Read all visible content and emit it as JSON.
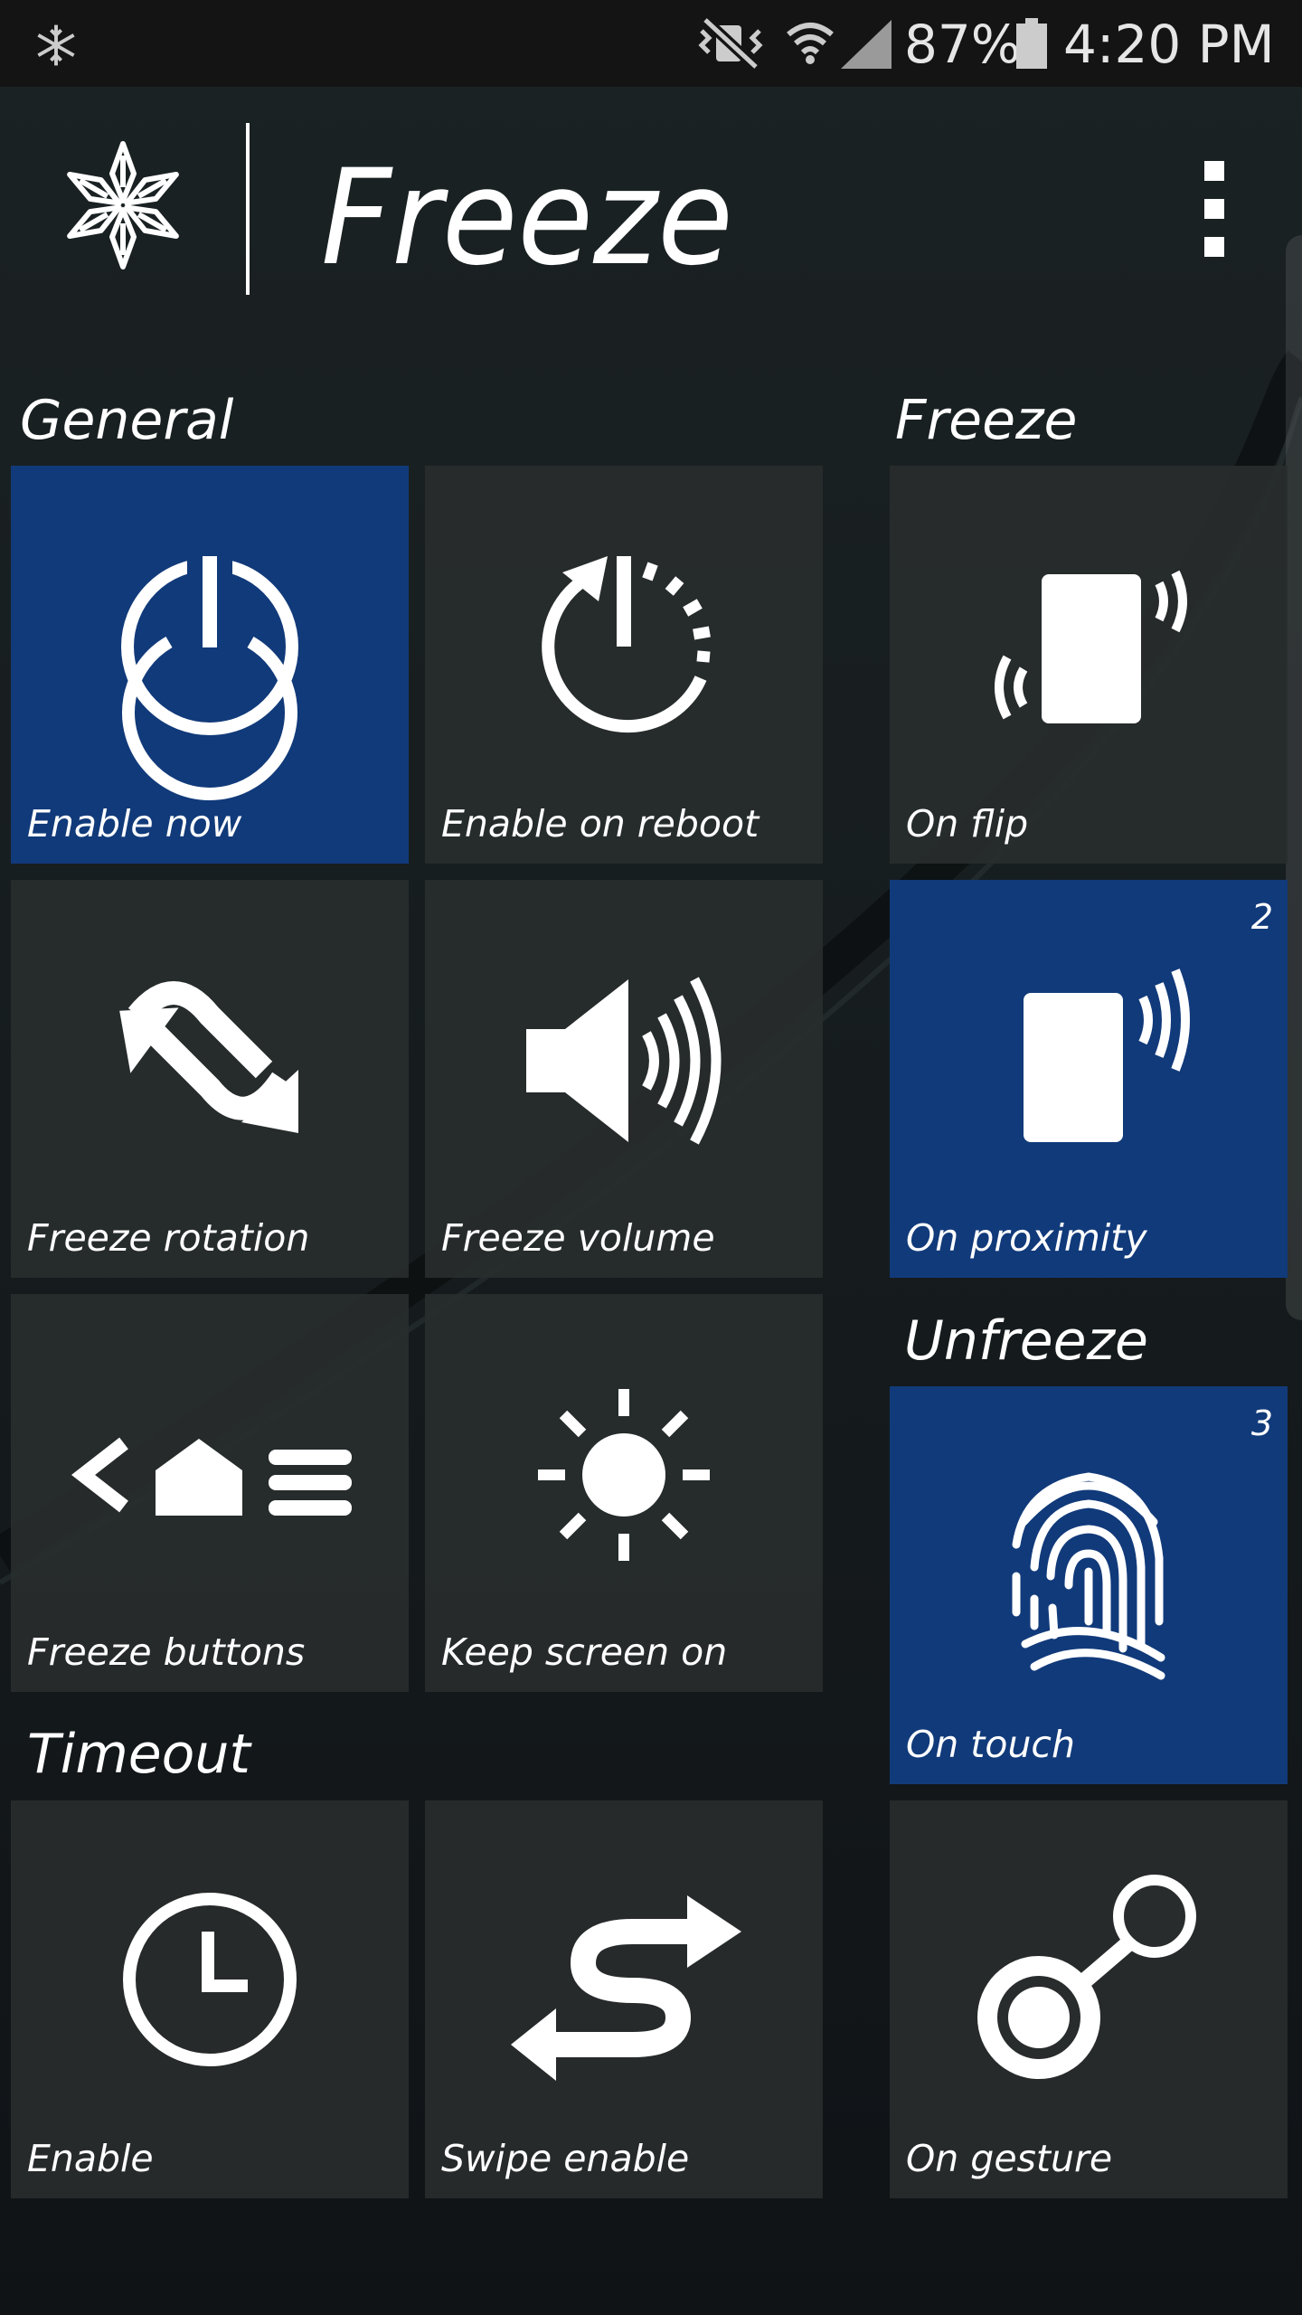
{
  "status_bar": {
    "battery": "87%",
    "time": "4:20 PM",
    "icons": [
      "snowflake-icon",
      "mute-vibrate-icon",
      "wifi-icon",
      "signal-icon",
      "battery-icon"
    ]
  },
  "app_bar": {
    "title": "Freeze",
    "icons": [
      "snowflake-logo-icon",
      "more-vert-icon"
    ]
  },
  "sections": {
    "general": "General",
    "freeze": "Freeze",
    "unfreeze": "Unfreeze",
    "timeout": "Timeout"
  },
  "tiles": {
    "enable_now": {
      "label": "Enable now",
      "icon": "power-icon",
      "active": true
    },
    "enable_on_reboot": {
      "label": "Enable on reboot",
      "icon": "reboot-icon",
      "active": false
    },
    "on_flip": {
      "label": "On flip",
      "icon": "phone-flip-icon",
      "active": false
    },
    "freeze_rotation": {
      "label": "Freeze rotation",
      "icon": "rotation-icon",
      "active": false
    },
    "freeze_volume": {
      "label": "Freeze volume",
      "icon": "volume-icon",
      "active": false
    },
    "on_proximity": {
      "label": "On proximity",
      "icon": "proximity-icon",
      "active": true,
      "badge": "2"
    },
    "freeze_buttons": {
      "label": "Freeze buttons",
      "icon": "nav-buttons-icon",
      "active": false
    },
    "keep_screen_on": {
      "label": "Keep screen on",
      "icon": "brightness-icon",
      "active": false
    },
    "on_touch": {
      "label": "On touch",
      "icon": "fingerprint-icon",
      "active": true,
      "badge": "3"
    },
    "timeout_enable": {
      "label": "Enable",
      "icon": "clock-icon",
      "active": false
    },
    "swipe_enable": {
      "label": "Swipe enable",
      "icon": "swipe-icon",
      "active": false
    },
    "on_gesture": {
      "label": "On gesture",
      "icon": "gesture-icon",
      "active": false
    }
  },
  "colors": {
    "background": "#141a1d",
    "tile": "#2a2e2e",
    "tile_active": "#113a7a",
    "text": "#ffffff"
  }
}
